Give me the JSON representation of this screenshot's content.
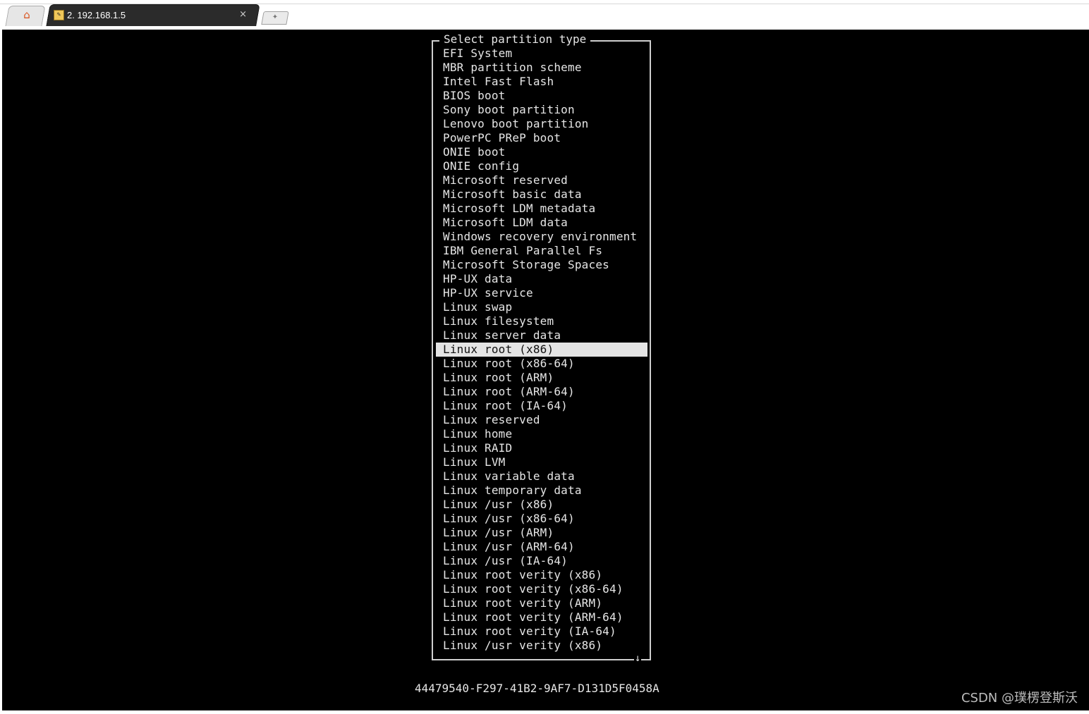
{
  "tabs": {
    "home_icon": "home-icon",
    "active_title": "2. 192.168.1.5",
    "active_icon": "terminal-tab-icon",
    "close_icon": "close-icon",
    "close_glyph": "×",
    "new_tab_icon": "new-tab-icon"
  },
  "terminal": {
    "menu_title": "Select partition type",
    "selected_index": 22,
    "items": [
      "EFI System",
      "MBR partition scheme",
      "Intel Fast Flash",
      "BIOS boot",
      "Sony boot partition",
      "Lenovo boot partition",
      "PowerPC PReP boot",
      "ONIE boot",
      "ONIE config",
      "Microsoft reserved",
      "Microsoft basic data",
      "Microsoft LDM metadata",
      "Microsoft LDM data",
      "Windows recovery environment",
      "IBM General Parallel Fs",
      "Microsoft Storage Spaces",
      "HP-UX data",
      "HP-UX service",
      "Linux swap",
      "Linux filesystem",
      "Linux server data",
      "Linux root (x86)",
      "Linux root (x86-64)",
      "Linux root (ARM)",
      "Linux root (ARM-64)",
      "Linux root (IA-64)",
      "Linux reserved",
      "Linux home",
      "Linux RAID",
      "Linux LVM",
      "Linux variable data",
      "Linux temporary data",
      "Linux /usr (x86)",
      "Linux /usr (x86-64)",
      "Linux /usr (ARM)",
      "Linux /usr (ARM-64)",
      "Linux /usr (IA-64)",
      "Linux root verity (x86)",
      "Linux root verity (x86-64)",
      "Linux root verity (ARM)",
      "Linux root verity (ARM-64)",
      "Linux root verity (IA-64)",
      "Linux /usr verity (x86)"
    ],
    "scroll_indicator": "↓",
    "uuid": "44479540-F297-41B2-9AF7-D131D5F0458A"
  },
  "watermark": "CSDN @璞楞登斯沃",
  "colors": {
    "terminal_bg": "#000000",
    "terminal_fg": "#e6e6e6",
    "selection_bg": "#e4e4e4",
    "selection_fg": "#111111"
  }
}
